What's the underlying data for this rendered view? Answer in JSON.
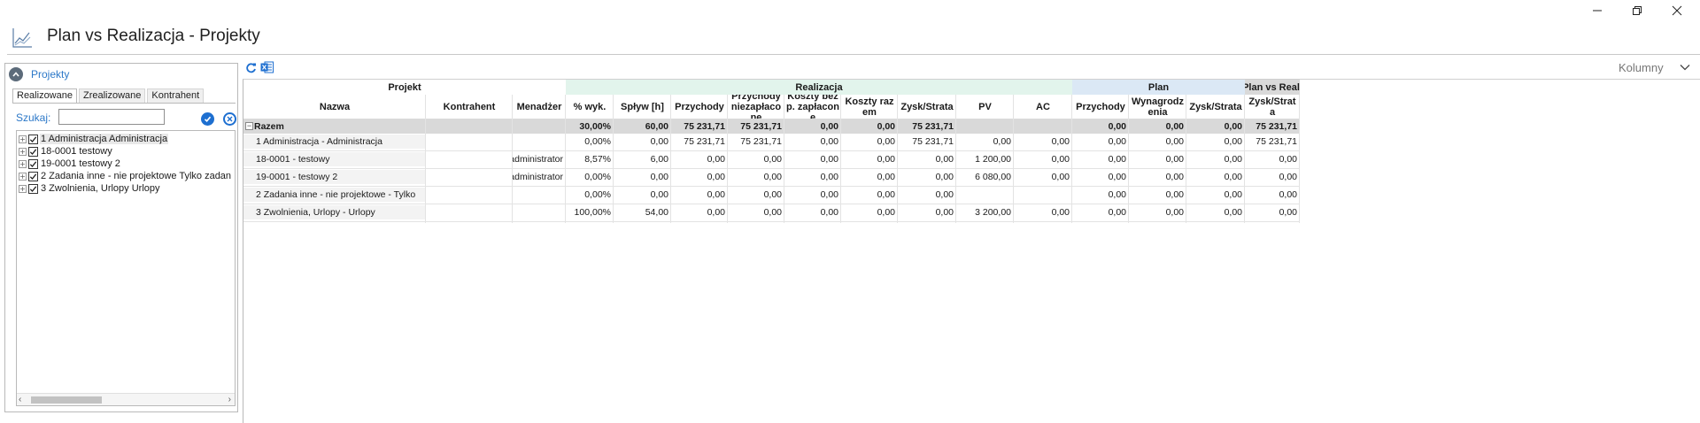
{
  "window": {
    "title": "Plan vs Realizacja - Projekty",
    "controls": [
      "minimize-icon",
      "restore-icon",
      "close-icon"
    ]
  },
  "left_panel": {
    "title": "Projekty",
    "tabs": [
      "Realizowane",
      "Zrealizowane",
      "Kontrahent"
    ],
    "active_tab": "Realizowane",
    "search_label": "Szukaj:",
    "search_value": "",
    "tree": [
      {
        "label": "1 Administracja Administracja",
        "checked": true,
        "selected": true
      },
      {
        "label": "18-0001 testowy",
        "checked": true
      },
      {
        "label": "19-0001 testowy 2",
        "checked": true
      },
      {
        "label": "2 Zadania inne - nie projektowe Tylko zadan",
        "checked": true
      },
      {
        "label": "3 Zwolnienia, Urlopy Urlopy",
        "checked": true
      }
    ]
  },
  "toolbar": {
    "refresh_icon": "refresh-icon",
    "excel_icon": "excel-export-icon",
    "columns_label": "Kolumny"
  },
  "colors": {
    "realizacja_group": "#e2f4ec",
    "plan_group": "#dbe8f5",
    "plan_vs_real_group": "#d9d9d9",
    "accent": "#2c78c8"
  },
  "grid": {
    "groups": [
      {
        "label": "Projekt"
      },
      {
        "label": "Realizacja"
      },
      {
        "label": "Plan"
      },
      {
        "label": "Plan vs Real."
      }
    ],
    "columns": [
      "Nazwa",
      "Kontrahent",
      "Menadżer",
      "% wyk.",
      "Spływ [h]",
      "Przychody",
      "Przychody niezapłacone",
      "Koszty bezp. zapłacone",
      "Koszty razem",
      "Zysk/Strata",
      "PV",
      "AC",
      "Przychody",
      "Wynagrodzenia",
      "Zysk/Strata",
      "Zysk/Strata"
    ],
    "totals": [
      "Razem",
      "",
      "",
      "30,00%",
      "60,00",
      "75 231,71",
      "75 231,71",
      "0,00",
      "0,00",
      "75 231,71",
      "",
      "",
      "0,00",
      "0,00",
      "0,00",
      "75 231,71"
    ],
    "rows": [
      [
        "1 Administracja - Administracja",
        "",
        "",
        "0,00%",
        "0,00",
        "75 231,71",
        "75 231,71",
        "0,00",
        "0,00",
        "75 231,71",
        "0,00",
        "0,00",
        "0,00",
        "0,00",
        "0,00",
        "75 231,71"
      ],
      [
        "18-0001 - testowy",
        "",
        "administrator",
        "8,57%",
        "6,00",
        "0,00",
        "0,00",
        "0,00",
        "0,00",
        "0,00",
        "1 200,00",
        "0,00",
        "0,00",
        "0,00",
        "0,00",
        "0,00"
      ],
      [
        "19-0001 - testowy 2",
        "",
        "administrator",
        "0,00%",
        "0,00",
        "0,00",
        "0,00",
        "0,00",
        "0,00",
        "0,00",
        "6 080,00",
        "0,00",
        "0,00",
        "0,00",
        "0,00",
        "0,00"
      ],
      [
        "2 Zadania inne - nie projektowe - Tylko",
        "",
        "",
        "0,00%",
        "0,00",
        "0,00",
        "0,00",
        "0,00",
        "0,00",
        "0,00",
        "",
        "",
        "0,00",
        "0,00",
        "0,00",
        "0,00"
      ],
      [
        "3 Zwolnienia, Urlopy - Urlopy",
        "",
        "",
        "100,00%",
        "54,00",
        "0,00",
        "0,00",
        "0,00",
        "0,00",
        "0,00",
        "3 200,00",
        "0,00",
        "0,00",
        "0,00",
        "0,00",
        "0,00"
      ]
    ]
  }
}
